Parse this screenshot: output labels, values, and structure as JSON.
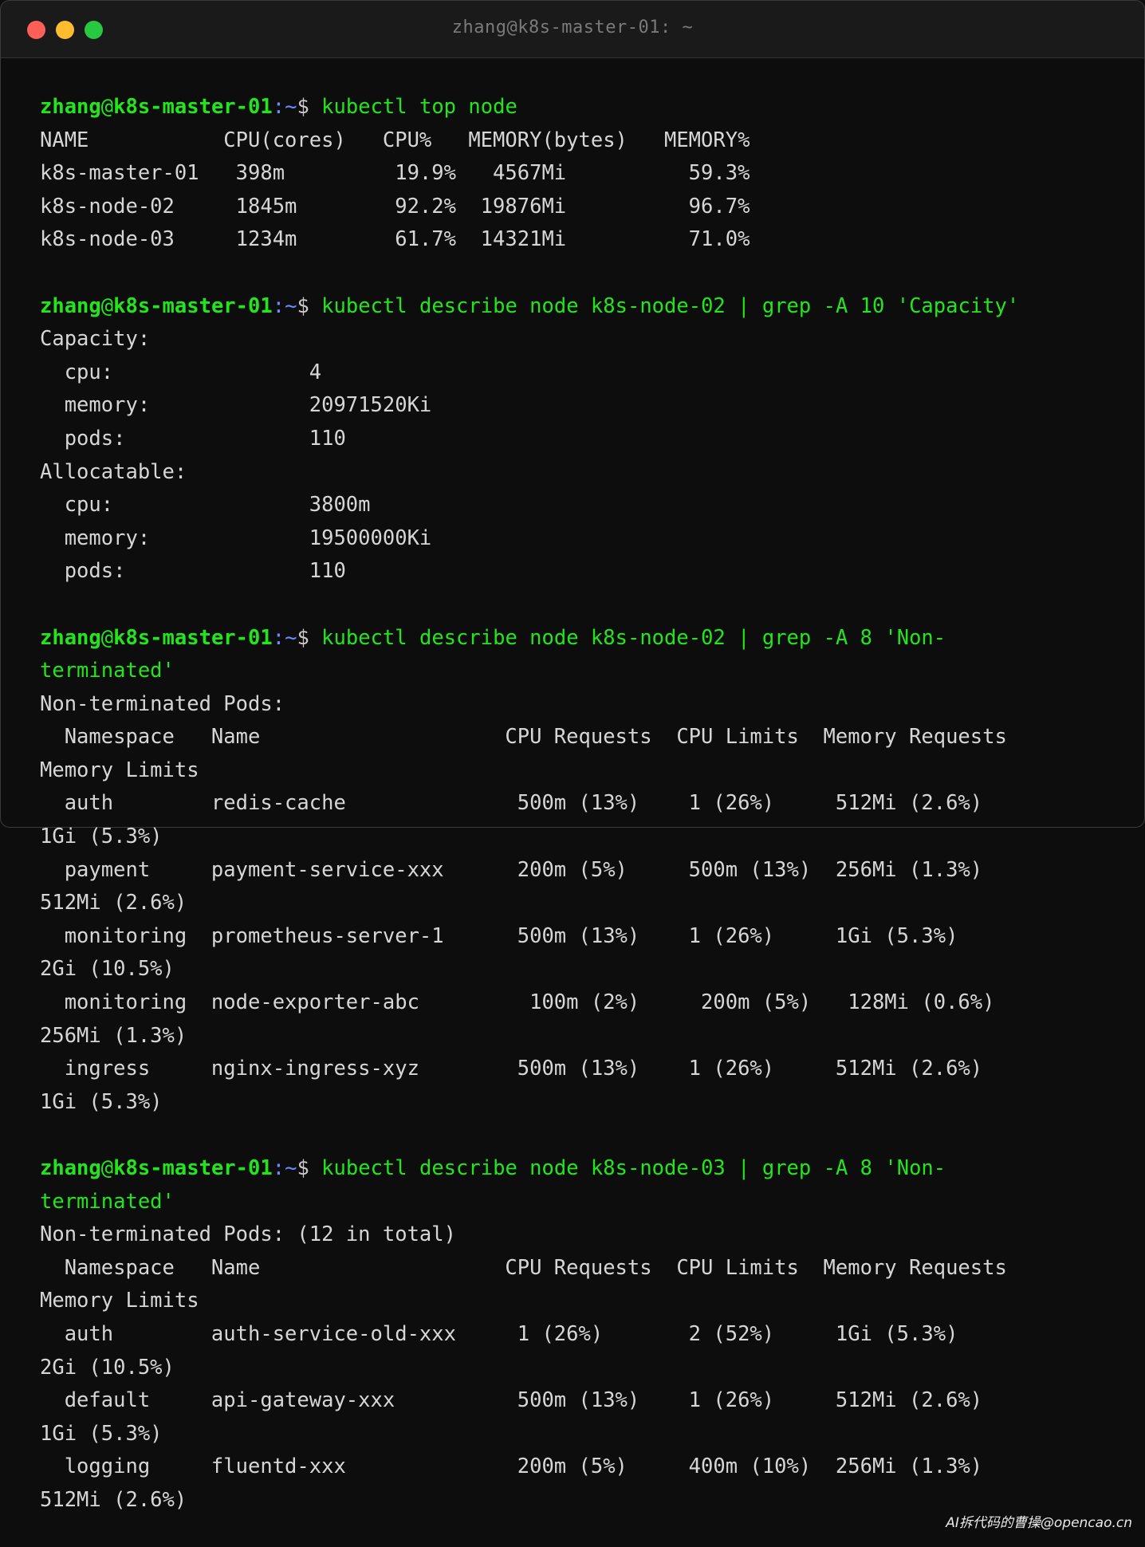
{
  "window": {
    "title": "zhang@k8s-master-01: ~"
  },
  "prompt": {
    "user": "zhang",
    "at": "@",
    "host": "k8s-master-01",
    "path": ":~",
    "dollar": "$ "
  },
  "commands": [
    "kubectl top node",
    "kubectl describe node k8s-node-02 | grep -A 10 'Capacity'",
    "kubectl describe node k8s-node-02 | grep -A 8 'Non-",
    "terminated'",
    "kubectl describe node k8s-node-03 | grep -A 8 'Non-",
    "terminated'"
  ],
  "outputs": {
    "top_node": [
      "NAME           CPU(cores)   CPU%   MEMORY(bytes)   MEMORY%",
      "k8s-master-01   398m         19.9%   4567Mi          59.3%",
      "k8s-node-02     1845m        92.2%  19876Mi          96.7%",
      "k8s-node-03     1234m        61.7%  14321Mi          71.0%"
    ],
    "capacity": [
      "Capacity:",
      "  cpu:                4",
      "  memory:             20971520Ki",
      "  pods:               110",
      "Allocatable:",
      "  cpu:                3800m",
      "  memory:             19500000Ki",
      "  pods:               110"
    ],
    "node02_pods": [
      "Non-terminated Pods:",
      "  Namespace   Name                    CPU Requests  CPU Limits  Memory Requests",
      "Memory Limits",
      "  auth        redis-cache              500m (13%)    1 (26%)     512Mi (2.6%)",
      "1Gi (5.3%)",
      "  payment     payment-service-xxx      200m (5%)     500m (13%)  256Mi (1.3%)",
      "512Mi (2.6%)",
      "  monitoring  prometheus-server-1      500m (13%)    1 (26%)     1Gi (5.3%)",
      "2Gi (10.5%)",
      "  monitoring  node-exporter-abc         100m (2%)     200m (5%)   128Mi (0.6%)",
      "256Mi (1.3%)",
      "  ingress     nginx-ingress-xyz        500m (13%)    1 (26%)     512Mi (2.6%)",
      "1Gi (5.3%)"
    ],
    "node03_pods": [
      "Non-terminated Pods: (12 in total)",
      "  Namespace   Name                    CPU Requests  CPU Limits  Memory Requests",
      "Memory Limits",
      "  auth        auth-service-old-xxx     1 (26%)       2 (52%)     1Gi (5.3%)",
      "2Gi (10.5%)",
      "  default     api-gateway-xxx          500m (13%)    1 (26%)     512Mi (2.6%)",
      "1Gi (5.3%)",
      "  logging     fluentd-xxx              200m (5%)     400m (10%)  256Mi (1.3%)",
      "512Mi (2.6%)"
    ]
  },
  "watermark": "AI拆代码的曹操@opencao.cn",
  "colors": {
    "prompt": "#22e61c",
    "path": "#6b8cff",
    "output": "#d6d6d6",
    "background": "#0d0d0d"
  }
}
